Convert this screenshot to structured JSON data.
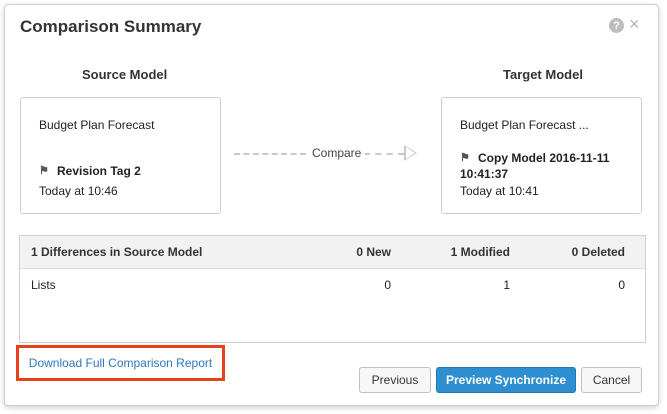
{
  "dialog": {
    "title": "Comparison Summary",
    "help_icon": "?",
    "close_icon": "×"
  },
  "source": {
    "heading": "Source Model",
    "name": "Budget Plan Forecast",
    "tag_icon": "tag-icon",
    "tag": "Revision Tag 2",
    "time": "Today at 10:46"
  },
  "target": {
    "heading": "Target Model",
    "name": "Budget Plan Forecast ...",
    "tag_icon": "tag-icon",
    "tag_line1": "Copy Model 2016-11-11",
    "tag_line2": "10:41:37",
    "time": "Today at 10:41"
  },
  "compare": {
    "label": "Compare"
  },
  "differences": {
    "header": {
      "title": "1 Differences in Source Model",
      "new": "0 New",
      "modified": "1 Modified",
      "deleted": "0 Deleted"
    },
    "rows": [
      {
        "name": "Lists",
        "new": "0",
        "modified": "1",
        "deleted": "0"
      }
    ]
  },
  "footer": {
    "download_link": "Download Full Comparison Report",
    "previous": "Previous",
    "preview_synchronize": "Preview Synchronize",
    "cancel": "Cancel"
  },
  "colors": {
    "primary": "#2e8fd0",
    "link": "#2f77bb",
    "highlight_border": "#e8401d"
  }
}
